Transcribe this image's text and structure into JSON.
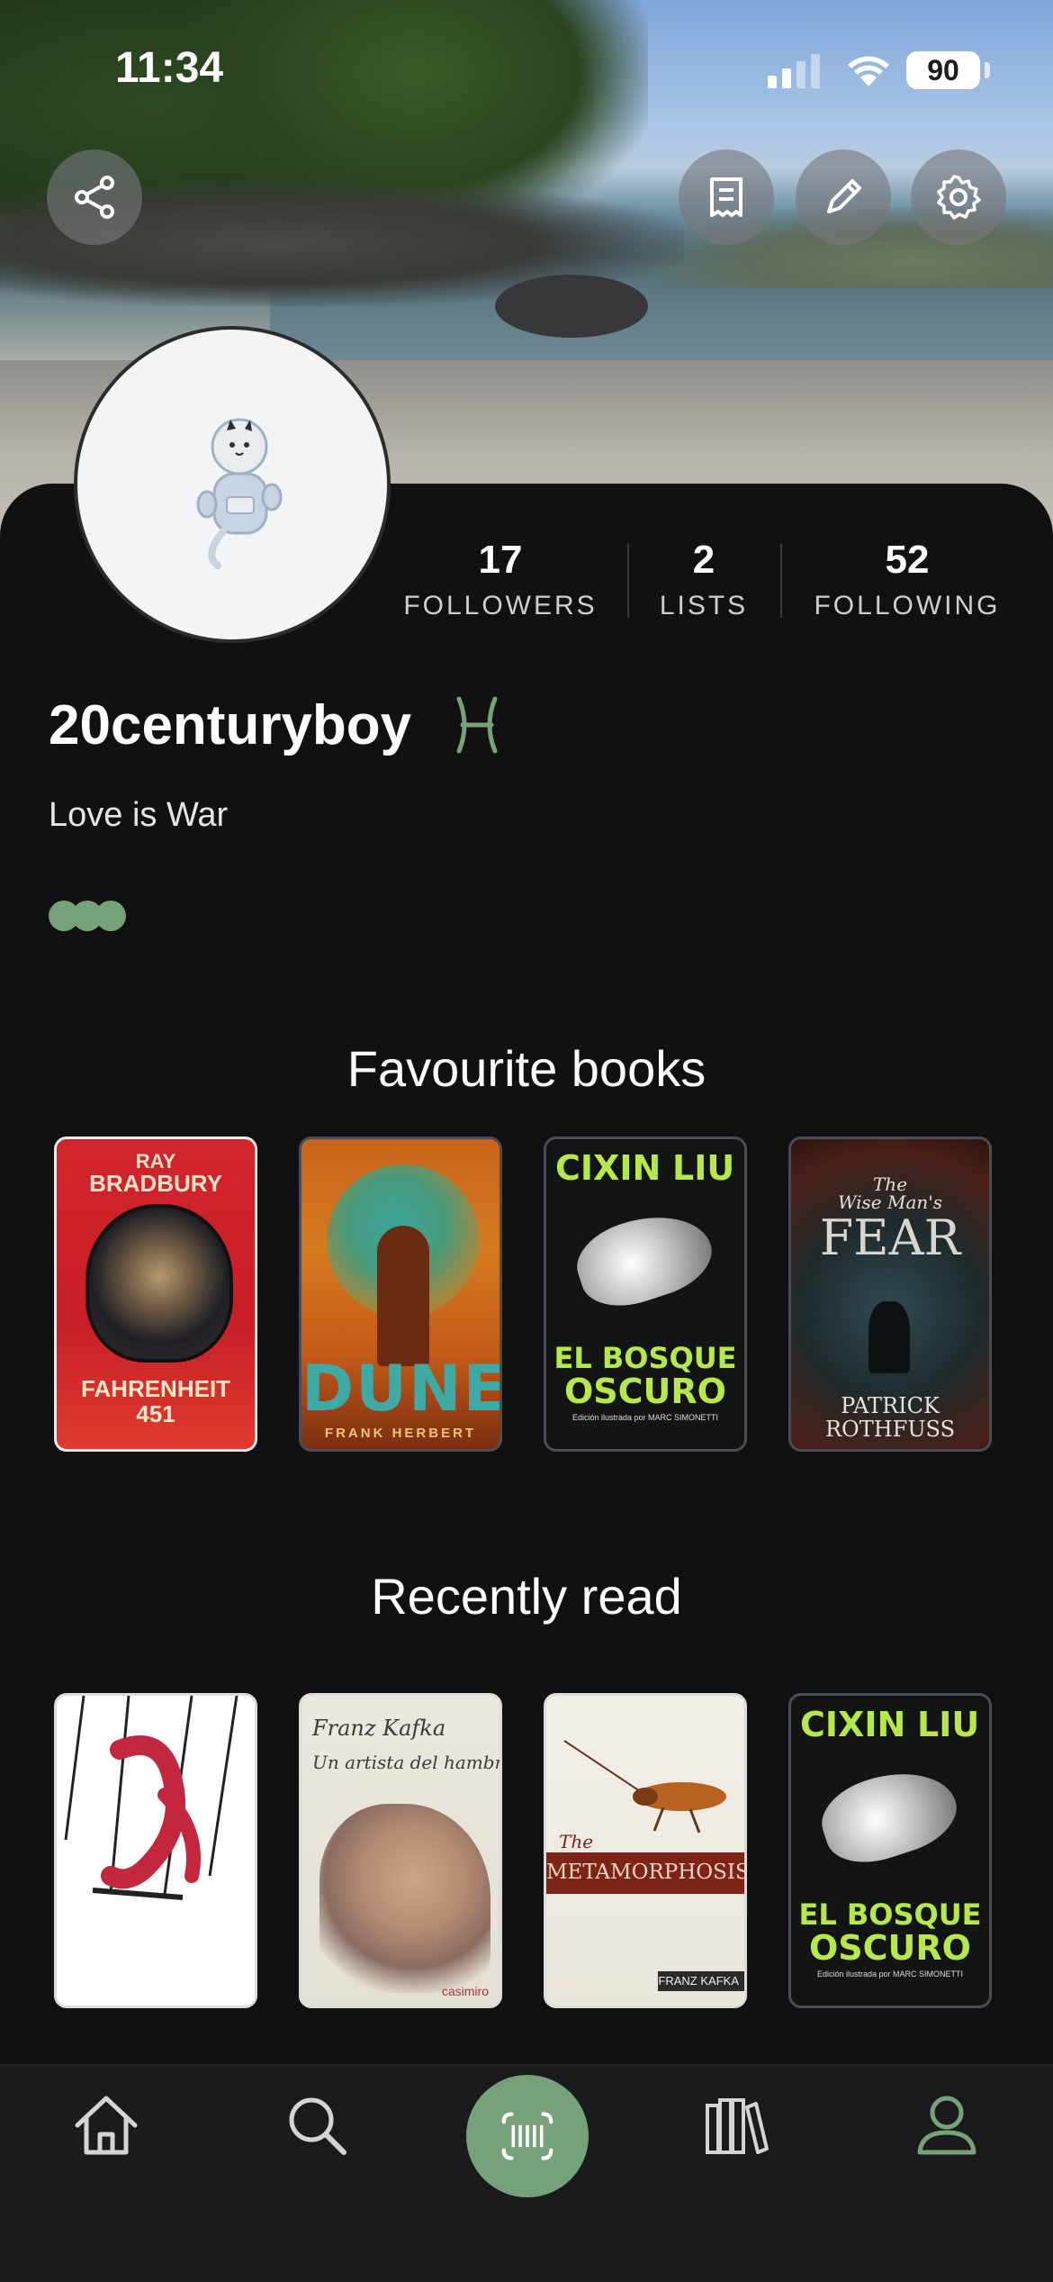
{
  "status_bar": {
    "time": "11:34",
    "battery": "90"
  },
  "profile": {
    "username": "20centuryboy",
    "zodiac_icon": "pisces-icon",
    "bio": "Love is War",
    "stats": [
      {
        "value": "17",
        "label": "FOLLOWERS"
      },
      {
        "value": "2",
        "label": "LISTS"
      },
      {
        "value": "52",
        "label": "FOLLOWING"
      }
    ]
  },
  "header_buttons": [
    "share-icon",
    "receipt-icon",
    "pencil-icon",
    "gear-icon"
  ],
  "favourite_books": {
    "title": "Favourite books",
    "books": [
      {
        "cover_lines": [
          "RAY",
          "BRADBURY",
          "FAHRENHEIT",
          "451"
        ]
      },
      {
        "cover_lines": [
          "DUNE",
          "FRANK HERBERT"
        ]
      },
      {
        "cover_lines": [
          "CIXIN",
          "LIU",
          "EL BOSQUE",
          "OSCURO",
          "Edición ilustrada por MARC SIMONETTI"
        ]
      },
      {
        "cover_lines": [
          "The",
          "Wise Man's",
          "FEAR",
          "PATRICK",
          "ROTHFUSS"
        ]
      }
    ]
  },
  "recently_read": {
    "title": "Recently read",
    "books": [
      {
        "cover_lines": []
      },
      {
        "cover_lines": [
          "Franz Kafka",
          "Un artista del hambre",
          "casimiro"
        ]
      },
      {
        "cover_lines": [
          "The",
          "METAMORPHOSIS",
          "FRANZ KAFKA"
        ]
      },
      {
        "cover_lines": [
          "CIXIN",
          "LIU",
          "EL BOSQUE",
          "OSCURO",
          "Edición ilustrada por MARC SIMONETTI"
        ]
      }
    ]
  },
  "nav": {
    "items": [
      "home-icon",
      "search-icon",
      "barcode-scan-icon",
      "library-icon",
      "profile-icon"
    ],
    "active": "profile-icon",
    "accent": "#76a179"
  }
}
